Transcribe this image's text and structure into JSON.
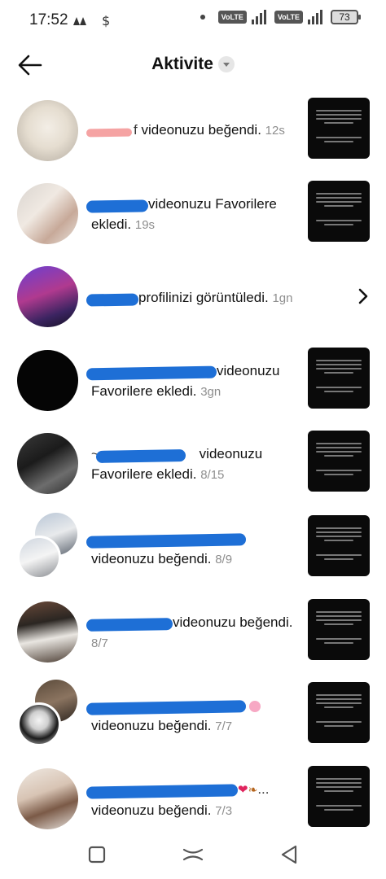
{
  "status_bar": {
    "time": "17:52",
    "volte1": "VoLTE",
    "volte2": "VoLTE",
    "battery": "73"
  },
  "header": {
    "title": "Aktivite",
    "back_icon": "arrow-left-icon",
    "dropdown_icon": "caret-down-icon"
  },
  "activities": [
    {
      "name": "f",
      "action": "videonuzu beğendi.",
      "time": "12s"
    },
    {
      "name": "",
      "action": "videonuzu Favorilere ekledi.",
      "time": "19s"
    },
    {
      "name": "",
      "action": "profilinizi görüntüledi.",
      "time": "1gn"
    },
    {
      "name": "",
      "action": "videonuzu Favorilere ekledi.",
      "time": "3gn"
    },
    {
      "name": "~",
      "action": "videonuzu Favorilere ekledi.",
      "time": "8/15"
    },
    {
      "name": "",
      "action": "videonuzu beğendi.",
      "time": "8/9"
    },
    {
      "name": "",
      "action": "videonuzu beğendi.",
      "time": "8/7"
    },
    {
      "name": "",
      "action": "videonuzu beğendi.",
      "time": "7/7"
    },
    {
      "name": "",
      "action": "videonuzu beğendi.",
      "time": "7/3"
    }
  ],
  "colors": {
    "redaction": "#1e6fd6",
    "time_gray": "#8e8e8e"
  }
}
